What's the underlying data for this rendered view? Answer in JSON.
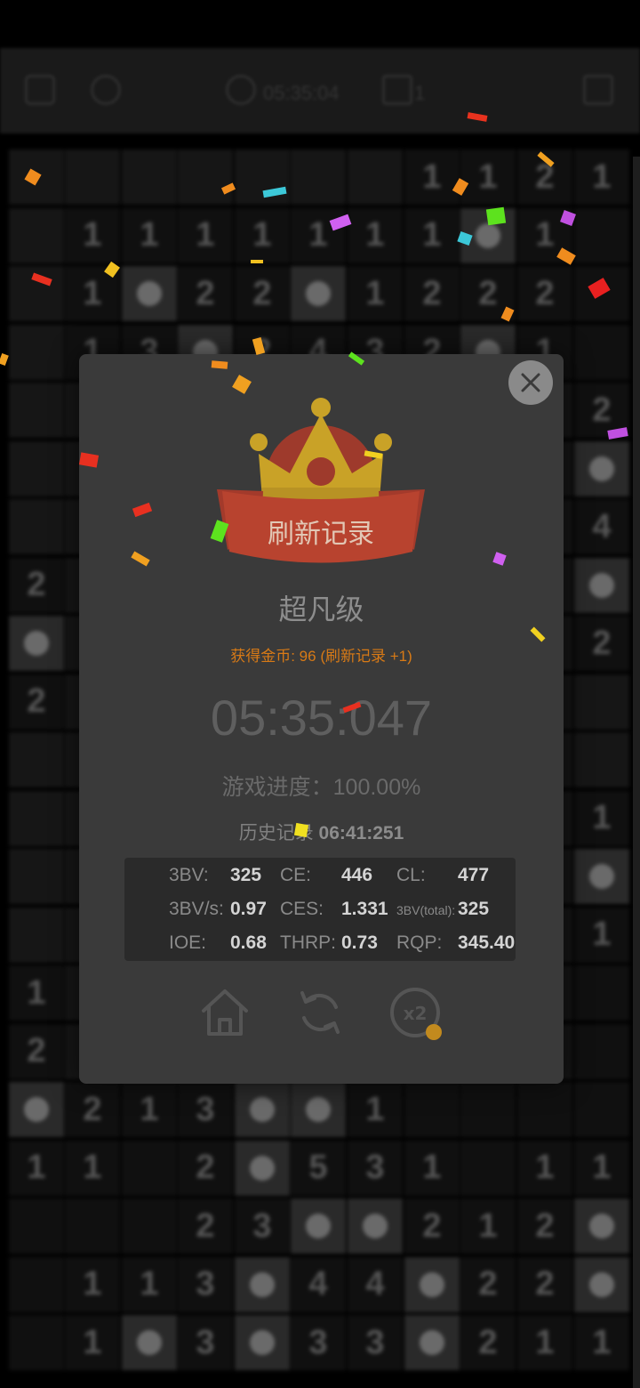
{
  "topbar": {
    "timer": "05:35:04",
    "flags": "1"
  },
  "board": {
    "cols": [
      41,
      104,
      168,
      231,
      295,
      358,
      422,
      486,
      549,
      613,
      677
    ],
    "rows": [
      [
        "c",
        "c",
        "c",
        "c",
        "c",
        "c",
        "c",
        "1",
        "1",
        "2",
        "1"
      ],
      [
        "c",
        "1",
        "1",
        "1",
        "1",
        "1",
        "1",
        "1",
        "m",
        "1",
        ""
      ],
      [
        "c",
        "1",
        "m",
        "2",
        "2",
        "m",
        "1",
        "2",
        "2",
        "2",
        ""
      ],
      [
        "c",
        "1",
        "3",
        "m",
        "2",
        "4",
        "3",
        "2",
        "m",
        "1",
        ""
      ],
      [
        "c",
        "c",
        "c",
        "c",
        "c",
        "c",
        "c",
        "c",
        "c",
        "c",
        "2"
      ],
      [
        "c",
        "c",
        "c",
        "c",
        "c",
        "c",
        "c",
        "c",
        "c",
        "c",
        "m"
      ],
      [
        "c",
        "c",
        "c",
        "c",
        "c",
        "c",
        "c",
        "c",
        "c",
        "c",
        "4"
      ],
      [
        "2",
        "c",
        "c",
        "c",
        "c",
        "c",
        "c",
        "c",
        "c",
        "c",
        "m"
      ],
      [
        "m",
        "c",
        "c",
        "c",
        "c",
        "c",
        "c",
        "c",
        "c",
        "c",
        "2"
      ],
      [
        "2",
        "c",
        "c",
        "c",
        "c",
        "c",
        "c",
        "c",
        "c",
        "c",
        "c"
      ],
      [
        "c",
        "c",
        "c",
        "c",
        "c",
        "c",
        "c",
        "c",
        "c",
        "c",
        "c"
      ],
      [
        "c",
        "c",
        "c",
        "c",
        "c",
        "c",
        "c",
        "c",
        "c",
        "c",
        "1"
      ],
      [
        "c",
        "c",
        "c",
        "c",
        "c",
        "c",
        "c",
        "c",
        "c",
        "c",
        "m"
      ],
      [
        "c",
        "c",
        "c",
        "c",
        "c",
        "c",
        "c",
        "c",
        "c",
        "c",
        "1"
      ],
      [
        "1",
        "c",
        "c",
        "c",
        "c",
        "c",
        "c",
        "c",
        "c",
        "c",
        ""
      ],
      [
        "2",
        "c",
        "c",
        "c",
        "c",
        "c",
        "c",
        "c",
        "c",
        "c",
        ""
      ],
      [
        "m",
        "2",
        "1",
        "3",
        "m",
        "m",
        "1",
        "",
        "",
        "",
        ""
      ],
      [
        "1",
        "1",
        "",
        "2",
        "m",
        "5",
        "3",
        "1",
        "",
        "1",
        "1"
      ],
      [
        "",
        "",
        "",
        "2",
        "3",
        "m",
        "m",
        "2",
        "1",
        "2",
        "m"
      ],
      [
        "",
        "1",
        "1",
        "3",
        "m",
        "4",
        "4",
        "m",
        "2",
        "2",
        "m"
      ],
      [
        "",
        "1",
        "m",
        "3",
        "m",
        "3",
        "3",
        "m",
        "2",
        "1",
        "1"
      ]
    ]
  },
  "modal": {
    "banner_text": "刷新记录",
    "level": "超凡级",
    "coins_text": "获得金币: 96 (刷新记录 +1)",
    "time": "05:35:047",
    "progress_text": "游戏进度：100.00%",
    "history_label": "历史记录",
    "history_value": "06:41:251",
    "stats": {
      "r1": {
        "l1": "3BV:",
        "v1": "325",
        "l2": "CE:",
        "v2": "446",
        "l3": "CL:",
        "v3": "477"
      },
      "r2": {
        "l1": "3BV/s:",
        "v1": "0.97",
        "l2": "CES:",
        "v2": "1.331",
        "l3": "3BV(total):",
        "v3": "325"
      },
      "r3": {
        "l1": "IOE:",
        "v1": "0.68",
        "l2": "THRP:",
        "v2": "0.73",
        "l3": "RQP:",
        "v3": "345.40"
      }
    },
    "double_label": "x2"
  },
  "colors": {
    "accent": "#d87a16",
    "crown": "#c9a227",
    "ribbon": "#b8432f"
  }
}
